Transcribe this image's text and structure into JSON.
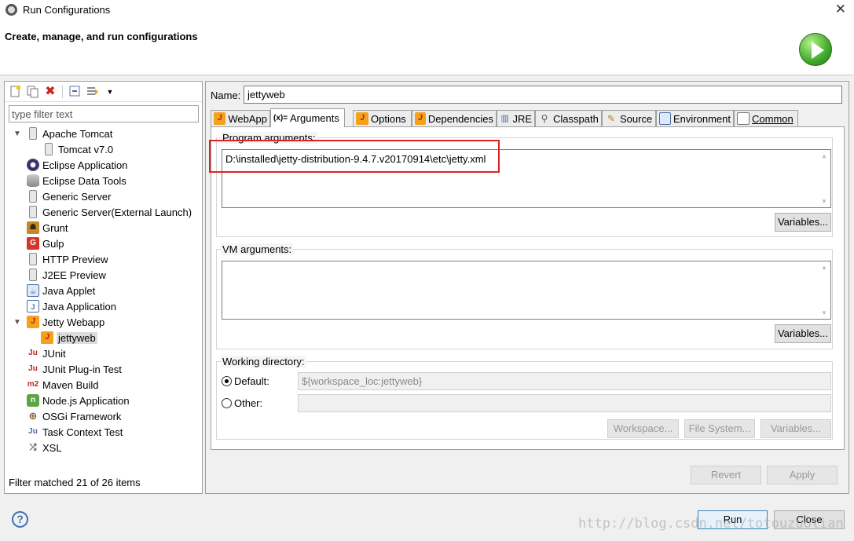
{
  "window": {
    "title": "Run Configurations",
    "close_glyph": "✕"
  },
  "banner": {
    "title": "Create, manage, and run configurations",
    "icon": "run-big-icon"
  },
  "left": {
    "filter_placeholder": "type filter text",
    "filter_value": "",
    "status": "Filter matched 21 of 26 items",
    "toolbar": [
      "new-configuration-icon",
      "duplicate-icon",
      "delete-icon",
      "collapse-all-icon",
      "filter-icon",
      "view-menu-icon"
    ],
    "tree": [
      {
        "label": "Apache Tomcat",
        "icon": "server-icon",
        "expanded": true,
        "level": 0
      },
      {
        "label": "Tomcat v7.0",
        "icon": "server-icon",
        "level": 1
      },
      {
        "label": "Eclipse Application",
        "icon": "eclipse-icon",
        "level": 0
      },
      {
        "label": "Eclipse Data Tools",
        "icon": "database-icon",
        "level": 0
      },
      {
        "label": "Generic Server",
        "icon": "server-icon",
        "level": 0
      },
      {
        "label": "Generic Server(External Launch)",
        "icon": "server-icon",
        "level": 0
      },
      {
        "label": "Grunt",
        "icon": "grunt-icon",
        "level": 0
      },
      {
        "label": "Gulp",
        "icon": "gulp-icon",
        "level": 0
      },
      {
        "label": "HTTP Preview",
        "icon": "server-icon",
        "level": 0
      },
      {
        "label": "J2EE Preview",
        "icon": "server-icon",
        "level": 0
      },
      {
        "label": "Java Applet",
        "icon": "applet-icon",
        "level": 0
      },
      {
        "label": "Java Application",
        "icon": "java-app-icon",
        "level": 0
      },
      {
        "label": "Jetty Webapp",
        "icon": "jetty-icon",
        "expanded": true,
        "level": 0
      },
      {
        "label": "jettyweb",
        "icon": "jetty-icon",
        "level": 1,
        "selected": true
      },
      {
        "label": "JUnit",
        "icon": "junit-icon",
        "level": 0
      },
      {
        "label": "JUnit Plug-in Test",
        "icon": "junit-plugin-icon",
        "level": 0
      },
      {
        "label": "Maven Build",
        "icon": "maven-icon",
        "level": 0
      },
      {
        "label": "Node.js Application",
        "icon": "nodejs-icon",
        "level": 0
      },
      {
        "label": "OSGi Framework",
        "icon": "osgi-icon",
        "level": 0
      },
      {
        "label": "Task Context Test",
        "icon": "task-context-icon",
        "level": 0
      },
      {
        "label": "XSL",
        "icon": "xsl-icon",
        "level": 0
      }
    ]
  },
  "right": {
    "name_label": "Name:",
    "name_value": "jettyweb",
    "tabs": [
      {
        "label": "WebApp",
        "icon": "jetty-icon"
      },
      {
        "label": "Arguments",
        "icon": "arguments-icon",
        "active": true
      },
      {
        "label": "Options",
        "icon": "jetty-icon"
      },
      {
        "label": "Dependencies",
        "icon": "jetty-icon"
      },
      {
        "label": "JRE",
        "icon": "jre-icon"
      },
      {
        "label": "Classpath",
        "icon": "classpath-icon"
      },
      {
        "label": "Source",
        "icon": "source-icon"
      },
      {
        "label": "Environment",
        "icon": "environment-icon"
      },
      {
        "label": "Common",
        "icon": "common-icon"
      }
    ],
    "program_args": {
      "label": "Program arguments:",
      "value": "D:\\installed\\jetty-distribution-9.4.7.v20170914\\etc\\jetty.xml",
      "variables_button": "Variables..."
    },
    "vm_args": {
      "label": "VM arguments:",
      "value": "",
      "variables_button": "Variables..."
    },
    "working_dir": {
      "label": "Working directory:",
      "default_label": "Default:",
      "default_value": "${workspace_loc:jettyweb}",
      "other_label": "Other:",
      "other_value": "",
      "selected": "default",
      "workspace_button": "Workspace...",
      "filesystem_button": "File System...",
      "variables_button": "Variables..."
    },
    "revert_button": "Revert",
    "apply_button": "Apply"
  },
  "footer": {
    "run_button": "Run",
    "close_button": "Close",
    "help": "?",
    "watermark": "http://blog.csdn.net/totouzuolian"
  }
}
